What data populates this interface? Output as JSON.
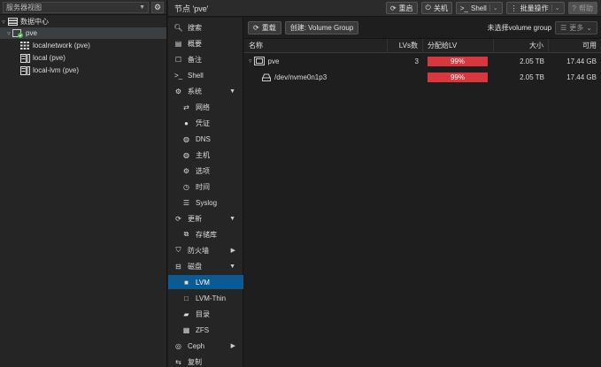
{
  "left": {
    "view_selector": "服务器视图",
    "tree": [
      {
        "label": "数据中心",
        "icon": "datacenter-icon"
      },
      {
        "label": "pve",
        "icon": "node-icon"
      },
      {
        "label": "localnetwork (pve)",
        "icon": "network-grid-icon"
      },
      {
        "label": "local (pve)",
        "icon": "storage-icon"
      },
      {
        "label": "local-lvm (pve)",
        "icon": "storage-icon"
      }
    ]
  },
  "header": {
    "title": "节点 'pve'",
    "buttons": {
      "reboot": "重启",
      "shutdown": "关机",
      "shell": "Shell",
      "bulk": "批量操作",
      "help": "帮助"
    }
  },
  "nav": [
    {
      "label": "搜索",
      "icon": "search-icon"
    },
    {
      "label": "概要",
      "icon": "book-icon"
    },
    {
      "label": "备注",
      "icon": "note-icon"
    },
    {
      "label": "Shell",
      "icon": "terminal-icon"
    },
    {
      "label": "系统",
      "icon": "gears-icon"
    },
    {
      "label": "网络",
      "icon": "network-arrows-icon"
    },
    {
      "label": "凭证",
      "icon": "certificate-icon"
    },
    {
      "label": "DNS",
      "icon": "globe-icon"
    },
    {
      "label": "主机",
      "icon": "globe-icon"
    },
    {
      "label": "选项",
      "icon": "gear-icon"
    },
    {
      "label": "时间",
      "icon": "clock-icon"
    },
    {
      "label": "Syslog",
      "icon": "list-icon"
    },
    {
      "label": "更新",
      "icon": "refresh-icon"
    },
    {
      "label": "存储库",
      "icon": "repository-icon"
    },
    {
      "label": "防火墙",
      "icon": "shield-icon"
    },
    {
      "label": "磁盘",
      "icon": "hdd-icon"
    },
    {
      "label": "LVM",
      "icon": "square-icon"
    },
    {
      "label": "LVM-Thin",
      "icon": "square-outline-icon"
    },
    {
      "label": "目录",
      "icon": "folder-icon"
    },
    {
      "label": "ZFS",
      "icon": "grid-icon"
    },
    {
      "label": "Ceph",
      "icon": "ceph-icon"
    },
    {
      "label": "复制",
      "icon": "retweet-icon"
    }
  ],
  "content": {
    "reload": "重载",
    "create_vg": "创建: Volume Group",
    "no_vg": "未选择volume group",
    "more": "更多",
    "columns": {
      "name": "名称",
      "lvs": "LVs数",
      "alloc": "分配给LV",
      "size": "大小",
      "free": "可用"
    },
    "rows": [
      {
        "name": "pve",
        "lvs": "3",
        "alloc": "99%",
        "size": "2.05 TB",
        "free": "17.44 GB"
      },
      {
        "name": "/dev/nvme0n1p3",
        "lvs": "",
        "alloc": "99%",
        "size": "2.05 TB",
        "free": "17.44 GB"
      }
    ],
    "bar_color": "#d9363e"
  },
  "colors": {
    "active_nav": "#0a5b94",
    "node_icon": "#4caf50"
  }
}
